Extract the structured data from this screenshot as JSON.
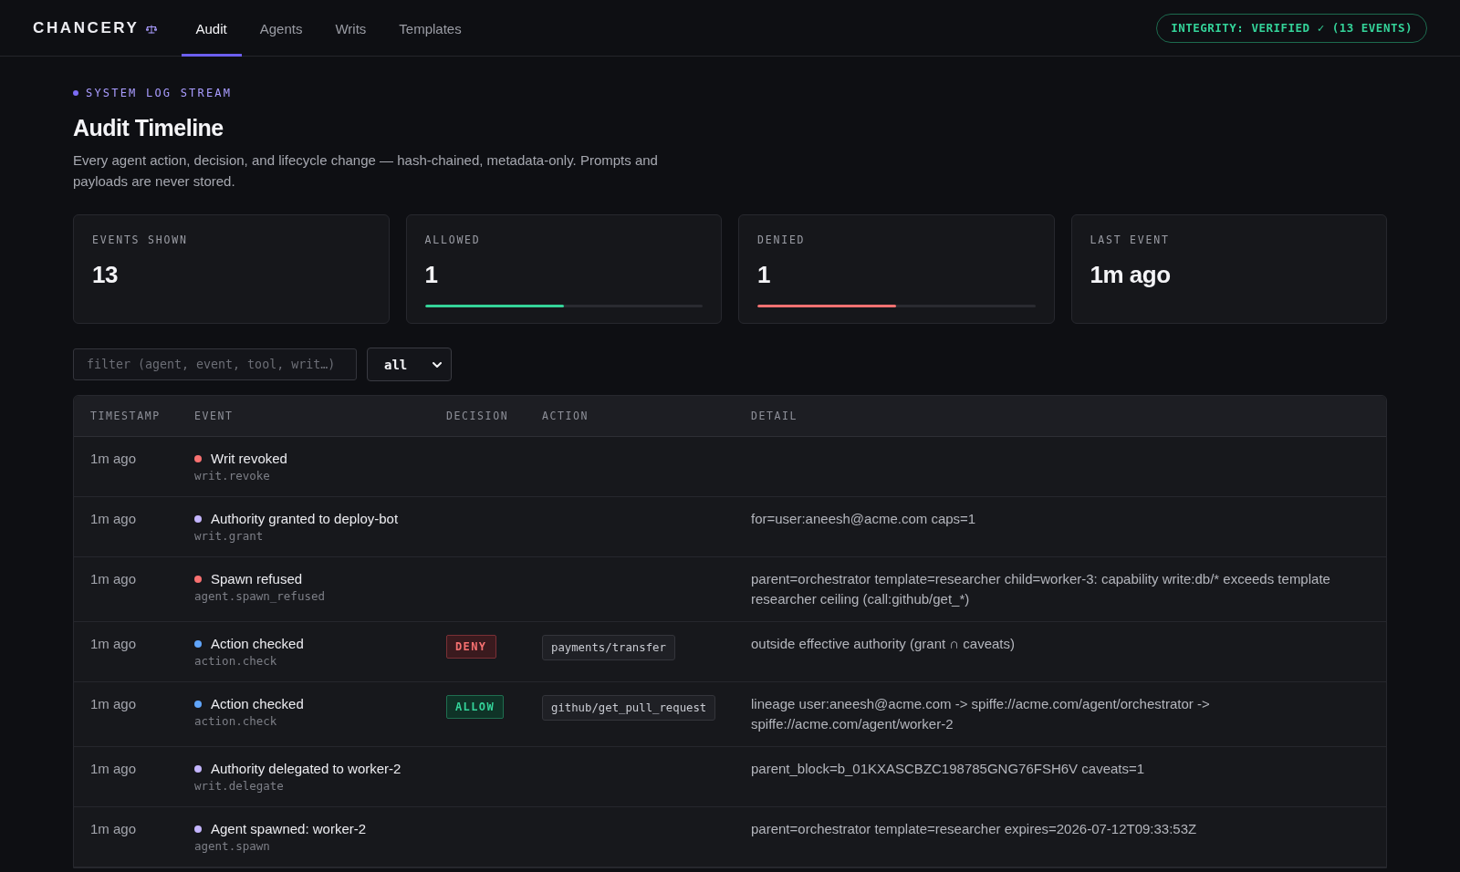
{
  "header": {
    "logo": "CHANCERY",
    "tabs": [
      {
        "label": "Audit",
        "selected": true
      },
      {
        "label": "Agents",
        "selected": false
      },
      {
        "label": "Writs",
        "selected": false
      },
      {
        "label": "Templates",
        "selected": false
      }
    ],
    "integrity_badge": "INTEGRITY: VERIFIED ✓ (13 EVENTS)"
  },
  "intro": {
    "eyebrow": "SYSTEM LOG STREAM",
    "title": "Audit Timeline",
    "description": "Every agent action, decision, and lifecycle change — hash-chained, metadata-only. Prompts and payloads are never stored."
  },
  "stats": [
    {
      "label": "EVENTS SHOWN",
      "value": "13"
    },
    {
      "label": "ALLOWED",
      "value": "1",
      "level": 0.5,
      "color": "#34d399"
    },
    {
      "label": "DENIED",
      "value": "1",
      "level": 0.5,
      "color": "#f87171"
    },
    {
      "label": "LAST EVENT",
      "value": "1m ago"
    }
  ],
  "filters": {
    "search": {
      "placeholder": "filter (agent, event, tool, writ…)"
    },
    "select": {
      "value": "all"
    }
  },
  "table": {
    "columns": [
      "TIMESTAMP",
      "EVENT",
      "DECISION",
      "ACTION",
      "DETAIL"
    ],
    "rows": [
      {
        "timestamp": "1m ago",
        "event": "Writ revoked",
        "event_type": "writ.revoke",
        "color": "#f87171"
      },
      {
        "timestamp": "1m ago",
        "event": "Authority granted to deploy-bot",
        "event_type": "writ.grant",
        "color": "#c4b5fd",
        "detail": "for=user:aneesh@acme.com caps=1"
      },
      {
        "timestamp": "1m ago",
        "event": "Spawn refused",
        "event_type": "agent.spawn_refused",
        "color": "#f87171",
        "detail": "parent=orchestrator template=researcher child=worker-3: capability write:db/* exceeds template researcher ceiling (call:github/get_*)"
      },
      {
        "timestamp": "1m ago",
        "event": "Action checked",
        "event_type": "action.check",
        "color": "#60a5fa",
        "decision": {
          "label": "DENY",
          "kind": "deny"
        },
        "action": "payments/transfer",
        "detail": "outside effective authority (grant ∩ caveats)"
      },
      {
        "timestamp": "1m ago",
        "event": "Action checked",
        "event_type": "action.check",
        "color": "#60a5fa",
        "decision": {
          "label": "ALLOW",
          "kind": "allow"
        },
        "action": "github/get_pull_request",
        "detail": "lineage user:aneesh@acme.com -> spiffe://acme.com/agent/orchestrator -> spiffe://acme.com/agent/worker-2"
      },
      {
        "timestamp": "1m ago",
        "event": "Authority delegated to worker-2",
        "event_type": "writ.delegate",
        "color": "#c4b5fd",
        "detail": "parent_block=b_01KXASCBZC198785GNG76FSH6V caveats=1"
      },
      {
        "timestamp": "1m ago",
        "event": "Agent spawned: worker-2",
        "event_type": "agent.spawn",
        "color": "#c4b5fd",
        "detail": "parent=orchestrator template=researcher expires=2026-07-12T09:33:53Z"
      }
    ]
  }
}
